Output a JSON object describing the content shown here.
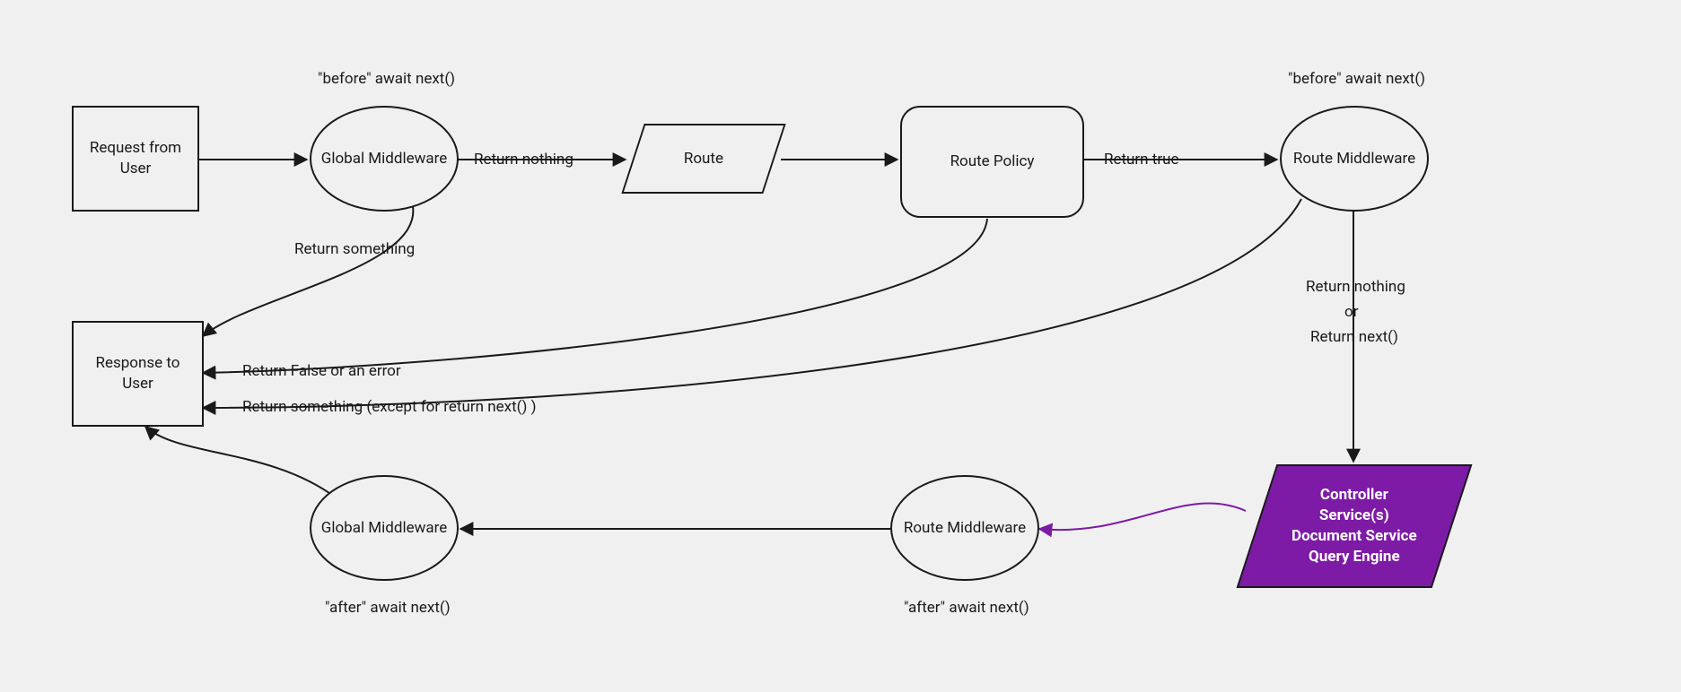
{
  "nodes": {
    "request": {
      "label": "Request from User"
    },
    "globalMwBefore": {
      "label": "Global Middleware",
      "caption": "\"before\" await next()"
    },
    "route": {
      "label": "Route"
    },
    "routePolicy": {
      "label": "Route Policy"
    },
    "routeMwBefore": {
      "label": "Route Middleware",
      "caption": "\"before\" await next()"
    },
    "controller": {
      "lines": [
        "Controller",
        "Service(s)",
        "Document Service",
        "Query Engine"
      ]
    },
    "routeMwAfter": {
      "label": "Route Middleware",
      "caption": "\"after\" await next()"
    },
    "globalMwAfter": {
      "label": "Global Middleware",
      "caption": "\"after\" await next()"
    },
    "response": {
      "label": "Response to User"
    }
  },
  "edges": {
    "returnNothing": "Return nothing",
    "returnTrue": "Return true",
    "returnSomething": "Return something",
    "returnFalseOrError": "Return False or an error",
    "returnSomethingExceptNext": "Return something (except for return next() )",
    "returnNothingOrNext1": "Return nothing",
    "returnNothingOrNext2": "or",
    "returnNothingOrNext3": "Return next()"
  },
  "colors": {
    "accent": "#7d1ba6",
    "stroke": "#1a1a1a",
    "bg": "#f0f0f0"
  }
}
